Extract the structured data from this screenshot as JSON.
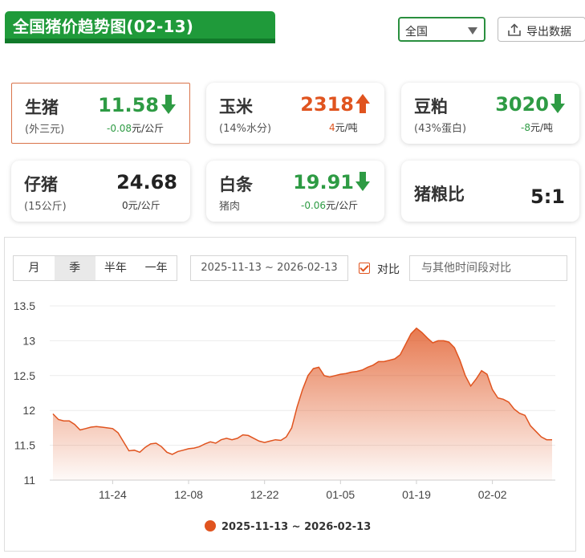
{
  "header": {
    "title": "全国猪价趋势图(02-13)",
    "region": "全国",
    "export_label": "导出数据"
  },
  "cards": [
    {
      "name": "生猪",
      "sub": "(外三元)",
      "price": "11.58",
      "change": "-0.08",
      "unit": "元/公斤",
      "trend": "down"
    },
    {
      "name": "玉米",
      "sub": "(14%水分)",
      "price": "2318",
      "change": "4",
      "unit": "元/吨",
      "trend": "up"
    },
    {
      "name": "豆粕",
      "sub": "(43%蛋白)",
      "price": "3020",
      "change": "-8",
      "unit": "元/吨",
      "trend": "down"
    },
    {
      "name": "仔猪",
      "sub": "(15公斤)",
      "price": "24.68",
      "change": "0",
      "unit": "元/公斤",
      "trend": "flat"
    },
    {
      "name": "白条",
      "sub": "猪肉",
      "price": "19.91",
      "change": "-0.06",
      "unit": "元/公斤",
      "trend": "down"
    },
    {
      "name": "猪粮比",
      "price": "5:1"
    }
  ],
  "controls": {
    "periods": [
      "月",
      "季",
      "半年",
      "一年"
    ],
    "selected_period": "季",
    "date_range": "2025-11-13 ~ 2026-02-13",
    "compare_label": "对比",
    "compare_checked": true,
    "compare_placeholder": "与其他时间段对比"
  },
  "colors": {
    "brand": "#1f9a3a",
    "up": "#e0541f",
    "down": "#2e9b44",
    "series": "#e0541f"
  },
  "chart_data": {
    "type": "area",
    "title": "",
    "xlabel": "",
    "ylabel": "",
    "ylim": [
      11,
      13.5
    ],
    "yticks": [
      "13.5",
      "13",
      "12.5",
      "12",
      "11.5",
      "11"
    ],
    "xticks": [
      "11-24",
      "12-08",
      "12-22",
      "01-05",
      "01-19",
      "02-02"
    ],
    "legend": "2025-11-13 ~ 2026-02-13",
    "legend_position": "bottom",
    "grid": true,
    "series": [
      {
        "name": "2025-11-13 ~ 2026-02-13",
        "x": [
          "11-13",
          "11-14",
          "11-15",
          "11-16",
          "11-17",
          "11-18",
          "11-19",
          "11-20",
          "11-21",
          "11-22",
          "11-23",
          "11-24",
          "11-25",
          "11-26",
          "11-27",
          "11-28",
          "11-29",
          "11-30",
          "12-01",
          "12-02",
          "12-03",
          "12-04",
          "12-05",
          "12-06",
          "12-07",
          "12-08",
          "12-09",
          "12-10",
          "12-11",
          "12-12",
          "12-13",
          "12-14",
          "12-15",
          "12-16",
          "12-17",
          "12-18",
          "12-19",
          "12-20",
          "12-21",
          "12-22",
          "12-23",
          "12-24",
          "12-25",
          "12-26",
          "12-27",
          "12-28",
          "12-29",
          "12-30",
          "12-31",
          "01-01",
          "01-02",
          "01-03",
          "01-04",
          "01-05",
          "01-06",
          "01-07",
          "01-08",
          "01-09",
          "01-10",
          "01-11",
          "01-12",
          "01-13",
          "01-14",
          "01-15",
          "01-16",
          "01-17",
          "01-18",
          "01-19",
          "01-20",
          "01-21",
          "01-22",
          "01-23",
          "01-24",
          "01-25",
          "01-26",
          "01-27",
          "01-28",
          "01-29",
          "01-30",
          "01-31",
          "02-01",
          "02-02",
          "02-03",
          "02-04",
          "02-05",
          "02-06",
          "02-07",
          "02-08",
          "02-09",
          "02-10",
          "02-11",
          "02-12",
          "02-13"
        ],
        "values": [
          11.95,
          11.87,
          11.85,
          11.85,
          11.8,
          11.72,
          11.74,
          11.76,
          11.77,
          11.76,
          11.75,
          11.74,
          11.68,
          11.55,
          11.42,
          11.43,
          11.4,
          11.47,
          11.52,
          11.53,
          11.48,
          11.4,
          11.37,
          11.41,
          11.43,
          11.45,
          11.46,
          11.48,
          11.52,
          11.55,
          11.53,
          11.58,
          11.6,
          11.58,
          11.6,
          11.65,
          11.64,
          11.6,
          11.56,
          11.54,
          11.56,
          11.58,
          11.57,
          11.62,
          11.75,
          12.05,
          12.3,
          12.5,
          12.6,
          12.62,
          12.5,
          12.48,
          12.5,
          12.52,
          12.53,
          12.55,
          12.56,
          12.58,
          12.62,
          12.65,
          12.7,
          12.7,
          12.72,
          12.74,
          12.8,
          12.95,
          13.1,
          13.18,
          13.12,
          13.04,
          12.97,
          13.0,
          13.0,
          12.98,
          12.9,
          12.72,
          12.5,
          12.35,
          12.45,
          12.57,
          12.52,
          12.3,
          12.18,
          12.16,
          12.12,
          12.02,
          11.96,
          11.93,
          11.78,
          11.7,
          11.62,
          11.58,
          11.58
        ]
      }
    ]
  }
}
